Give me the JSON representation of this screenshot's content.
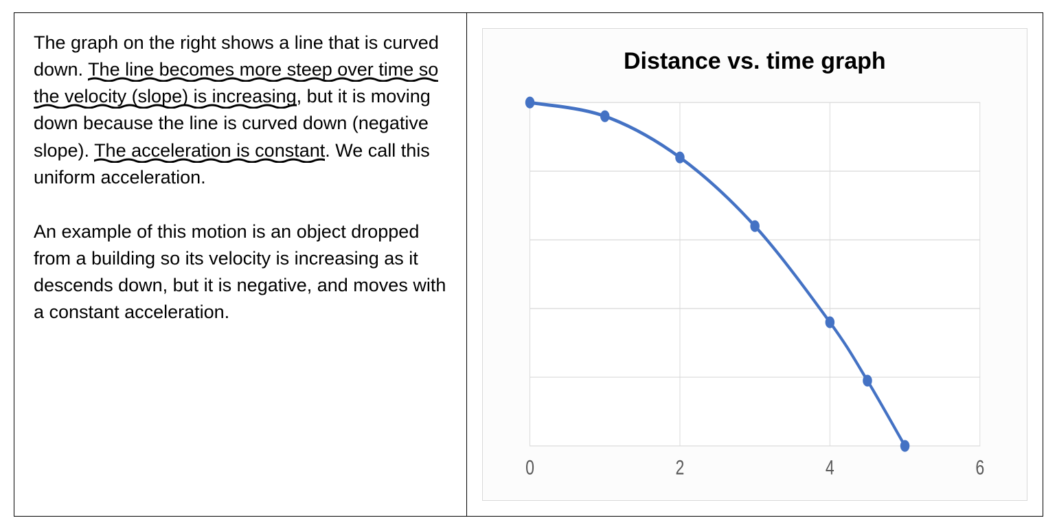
{
  "text": {
    "p1_a": "The graph on the right shows a line that is curved down. ",
    "p1_u1": "The line becomes more steep over time so the velocity (slope) is increasing",
    "p1_b": ", but it is moving down because the line is curved down (negative slope). ",
    "p1_u2": "The acceleration is constant",
    "p1_c": ". We call this uniform acceleration.",
    "p2": "An example of this motion is an object dropped from a building so its velocity is increasing as it descends down, but it is negative, and moves with a constant acceleration."
  },
  "chart_data": {
    "type": "line",
    "title": "Distance vs. time graph",
    "xlabel": "",
    "ylabel": "",
    "xlim": [
      0,
      6
    ],
    "ylim": [
      0,
      25
    ],
    "x_ticks": [
      0,
      2,
      4,
      6
    ],
    "y_ticks_count": 5,
    "series": [
      {
        "name": "distance",
        "color": "#4472C4",
        "x": [
          0,
          1,
          2,
          3,
          4,
          4.5,
          5
        ],
        "y": [
          25,
          24,
          21,
          16,
          9,
          4.75,
          0
        ]
      }
    ]
  }
}
